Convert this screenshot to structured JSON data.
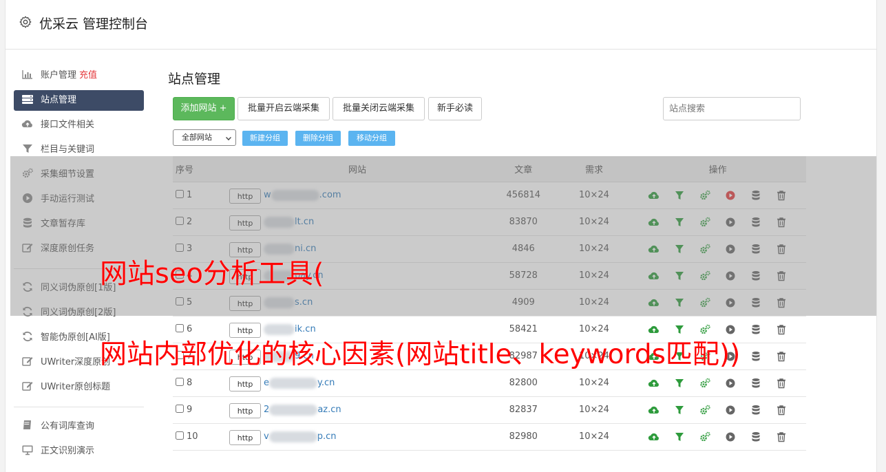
{
  "app": {
    "title": "优采云 管理控制台"
  },
  "sidebar": {
    "items": [
      {
        "label": "账户管理",
        "extra": "充值",
        "icon": "bar-chart-icon"
      },
      {
        "label": "站点管理",
        "icon": "server-icon",
        "active": true
      },
      {
        "label": "接口文件相关",
        "icon": "cloud-upload-icon"
      },
      {
        "label": "栏目与关键词",
        "icon": "filter-icon"
      },
      {
        "label": "采集细节设置",
        "icon": "cogs-icon"
      },
      {
        "label": "手动运行测试",
        "icon": "play-icon"
      },
      {
        "label": "文章暂存库",
        "icon": "database-icon"
      },
      {
        "label": "深度原创任务",
        "icon": "edit-icon"
      }
    ],
    "items2": [
      {
        "label": "同义词伪原创[1版]",
        "icon": "refresh-icon"
      },
      {
        "label": "同义词伪原创[2版]",
        "icon": "refresh-icon"
      },
      {
        "label": "智能伪原创[AI版]",
        "icon": "refresh-icon"
      },
      {
        "label": "UWriter深度原创",
        "icon": "edit-icon"
      },
      {
        "label": "UWriter原创标题",
        "icon": "edit-icon"
      }
    ],
    "items3": [
      {
        "label": "公有词库查询",
        "icon": "book-icon"
      },
      {
        "label": "正文识别演示",
        "icon": "monitor-icon"
      }
    ]
  },
  "main": {
    "title": "站点管理",
    "buttons": {
      "add_site": "添加网站 +",
      "batch_open": "批量开启云端采集",
      "batch_close": "批量关闭云端采集",
      "beginner": "新手必读"
    },
    "search_placeholder": "站点搜索",
    "group_select": "全部网站",
    "group_buttons": {
      "new": "新建分组",
      "delete": "删除分组",
      "move": "移动分组"
    }
  },
  "table": {
    "headers": {
      "no": "序号",
      "site": "网站",
      "articles": "文章",
      "demand": "需求",
      "ops": "操作"
    },
    "rows": [
      {
        "no": "1",
        "prefix": "w",
        "suffix": ".com",
        "articles": "456814",
        "demand": "10×24",
        "status": "running"
      },
      {
        "no": "2",
        "prefix": "",
        "suffix": "lt.cn",
        "articles": "83870",
        "demand": "10×24",
        "status": "stopped"
      },
      {
        "no": "3",
        "prefix": "",
        "suffix": "ni.cn",
        "articles": "4846",
        "demand": "10×24",
        "status": "stopped"
      },
      {
        "no": "4",
        "prefix": "",
        "suffix": "pay.cn",
        "articles": "58728",
        "demand": "10×24",
        "status": "stopped"
      },
      {
        "no": "5",
        "prefix": "",
        "suffix": "s.cn",
        "articles": "4909",
        "demand": "10×24",
        "status": "stopped"
      },
      {
        "no": "6",
        "prefix": "",
        "suffix": "ik.cn",
        "articles": "58421",
        "demand": "10×24",
        "status": "stopped"
      },
      {
        "no": "7",
        "prefix": "",
        "suffix": "9.cn",
        "articles": "82987",
        "demand": "10×24",
        "status": "stopped"
      },
      {
        "no": "8",
        "prefix": "e",
        "suffix": "y.cn",
        "articles": "82800",
        "demand": "10×24",
        "status": "stopped"
      },
      {
        "no": "9",
        "prefix": "2",
        "suffix": "az.cn",
        "articles": "82837",
        "demand": "10×24",
        "status": "stopped"
      },
      {
        "no": "10",
        "prefix": "v",
        "suffix": "p.cn",
        "articles": "82980",
        "demand": "10×24",
        "status": "stopped"
      }
    ],
    "http_label": "http"
  },
  "watermarks": {
    "line1": "网站seo分析工具(",
    "line2": "网站内部优化的核心因素(网站title、keywords匹配))"
  },
  "colors": {
    "sidebar_active": "#3d4b66",
    "primary_green": "#5cb85c",
    "link_blue": "#337ab7",
    "accent_red": "#e4393c",
    "watermark_red": "#ff0000"
  }
}
